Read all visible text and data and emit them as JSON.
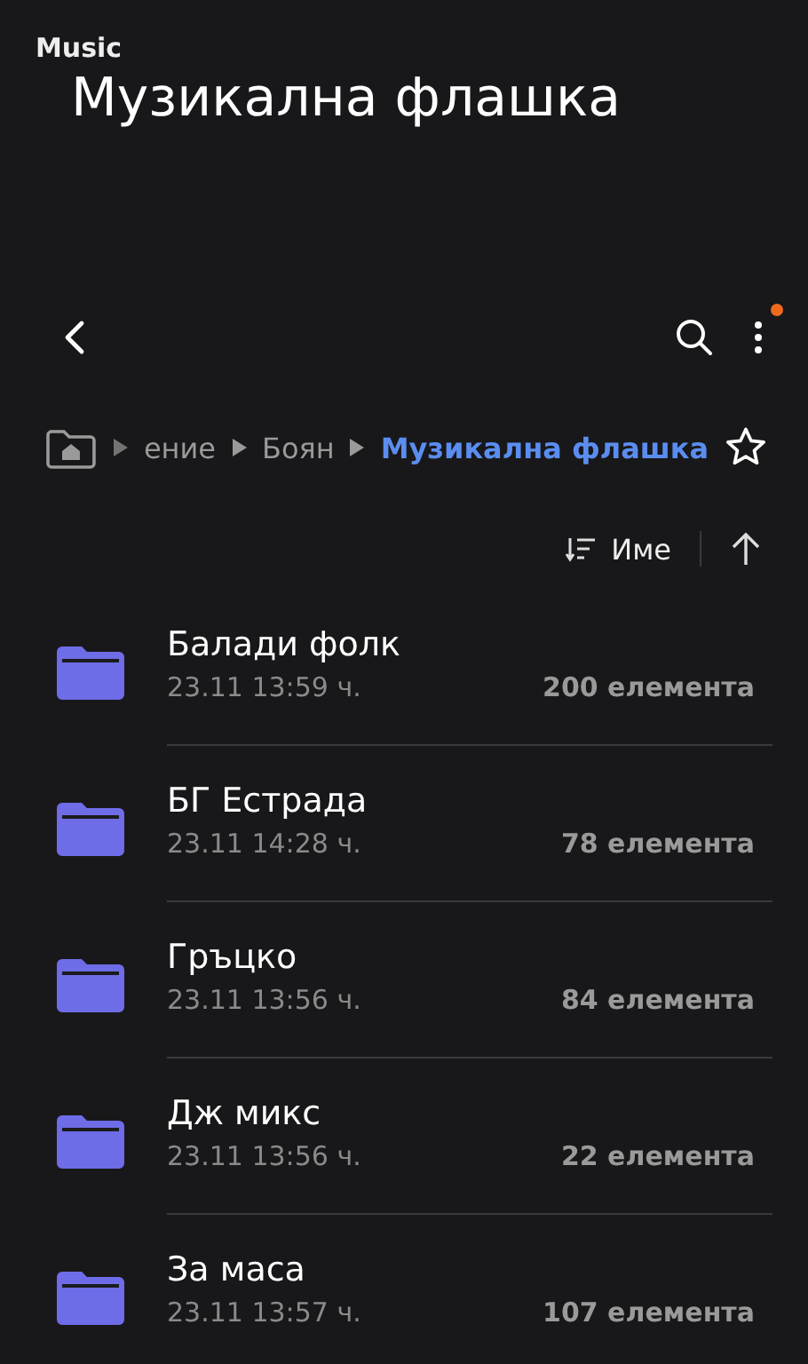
{
  "overlay": {
    "small_label": "Music",
    "title": "Музикална флашка"
  },
  "toolbar": {
    "menu_badge": true
  },
  "breadcrumb": {
    "items": [
      {
        "label": "ение",
        "selected": false
      },
      {
        "label": "Боян",
        "selected": false
      },
      {
        "label": "Музикална флашка",
        "selected": true
      }
    ],
    "favorite": false
  },
  "sort": {
    "label": "Име",
    "ascending": true
  },
  "folders": [
    {
      "name": "Балади фолк",
      "date": "23.11 13:59 ч.",
      "count": "200 елемента"
    },
    {
      "name": "БГ Естрада",
      "date": "23.11 14:28 ч.",
      "count": "78 елемента"
    },
    {
      "name": "Гръцко",
      "date": "23.11 13:56 ч.",
      "count": "84 елемента"
    },
    {
      "name": "Дж микс",
      "date": "23.11 13:56 ч.",
      "count": "22 елемента"
    },
    {
      "name": "За маса",
      "date": "23.11 13:57 ч.",
      "count": "107 елемента"
    }
  ]
}
